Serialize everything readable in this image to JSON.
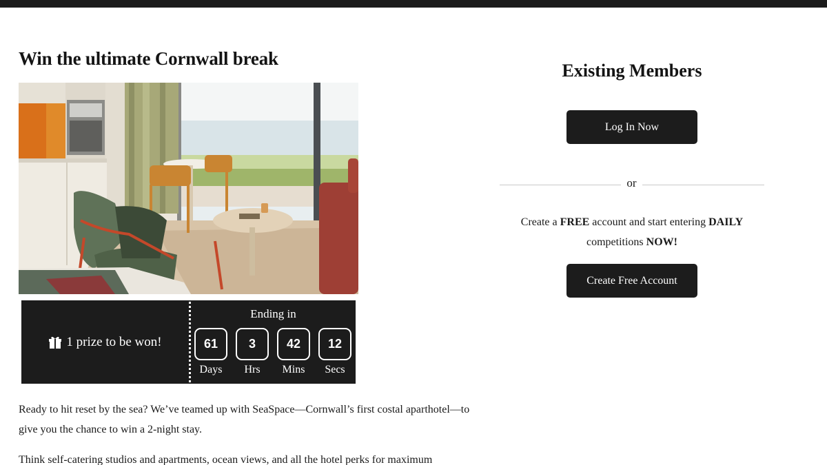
{
  "colors": {
    "dark": "#1c1c1c",
    "background": "#ffffff",
    "divider": "#c9c9c9"
  },
  "competition": {
    "title": "Win the ultimate Cornwall break",
    "image_alt_icon": "hotel-room-photo",
    "prize_icon": "gift-icon",
    "prize_text": "1 prize to be won!",
    "countdown": {
      "heading": "Ending in",
      "days": "61",
      "hours": "3",
      "mins": "42",
      "secs": "12",
      "days_label": "Days",
      "hours_label": "Hrs",
      "mins_label": "Mins",
      "secs_label": "Secs"
    },
    "paragraphs": [
      "Ready to hit reset by the sea? We’ve teamed up with SeaSpace—Cornwall’s first costal aparthotel—to give you the chance to win a 2-night stay.",
      "Think self-catering studios and apartments, ocean views, and all the hotel perks for maximum"
    ]
  },
  "members": {
    "title": "Existing Members",
    "login_label": "Log In Now",
    "or_label": "or",
    "create_part1": "Create a ",
    "create_free": "FREE",
    "create_part2": " account and start entering ",
    "create_daily": "DAILY",
    "create_part3": " competitions ",
    "create_now": "NOW!",
    "create_button_label": "Create Free Account"
  }
}
